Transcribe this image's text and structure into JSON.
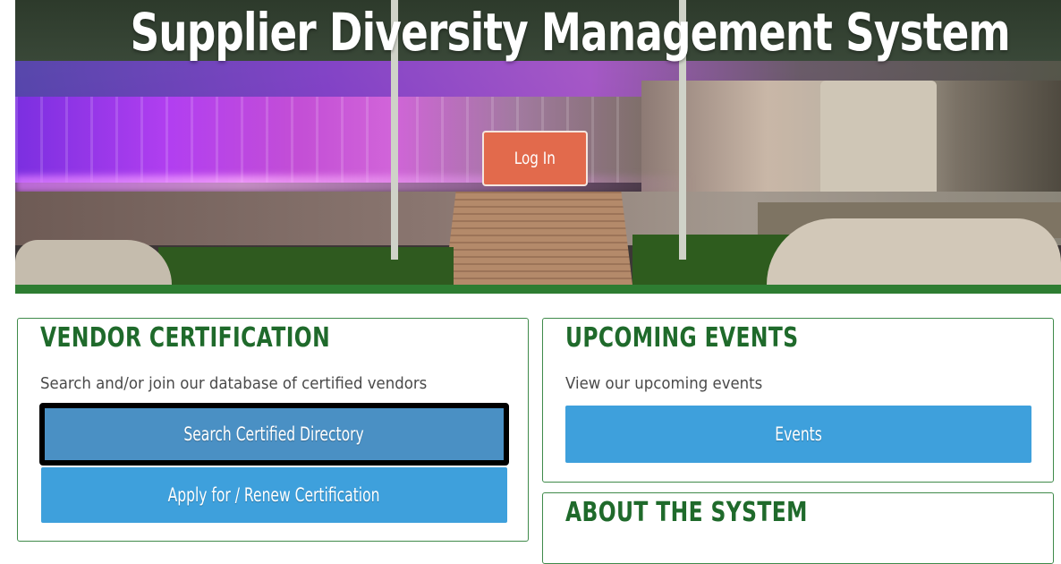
{
  "hero": {
    "title": "Supplier Diversity Management System",
    "login_label": "Log In"
  },
  "vendor": {
    "heading": "VENDOR CERTIFICATION",
    "description": "Search and/or join our database of certified vendors",
    "search_label": "Search Certified Directory",
    "apply_label": "Apply for / Renew Certification"
  },
  "events": {
    "heading": "UPCOMING EVENTS",
    "description": "View our upcoming events",
    "button_label": "Events"
  },
  "about": {
    "heading": "ABOUT THE SYSTEM"
  },
  "colors": {
    "brand_green": "#2e7d32",
    "heading_green": "#1f6a2b",
    "button_blue": "#3ea0dc",
    "login_orange": "#e26a4c"
  }
}
